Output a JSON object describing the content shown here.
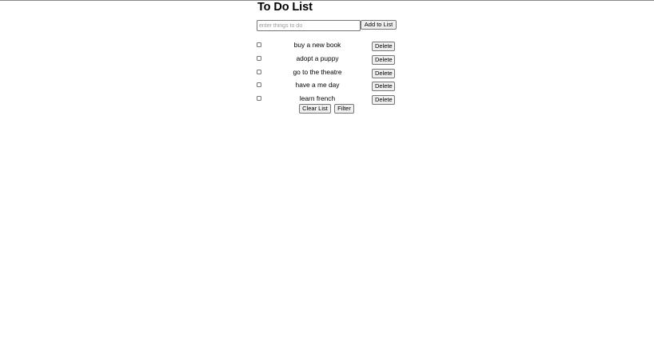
{
  "app": {
    "title": "To Do List"
  },
  "add_form": {
    "placeholder": "enter things to do",
    "value": "",
    "add_button_label": "Add to List"
  },
  "todos": [
    {
      "text": "buy a new book",
      "checked": false,
      "delete_label": "Delete"
    },
    {
      "text": "adopt a puppy",
      "checked": false,
      "delete_label": "Delete"
    },
    {
      "text": "go to the theatre",
      "checked": false,
      "delete_label": "Delete"
    },
    {
      "text": "have a me day",
      "checked": false,
      "delete_label": "Delete"
    },
    {
      "text": "learn french",
      "checked": false,
      "delete_label": "Delete"
    }
  ],
  "footer": {
    "clear_label": "Clear List",
    "filter_label": "Filter"
  }
}
